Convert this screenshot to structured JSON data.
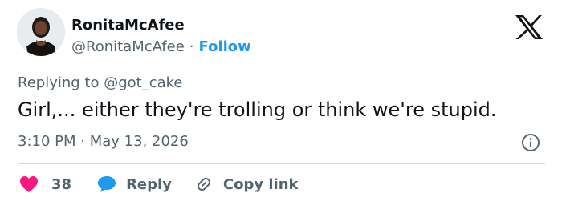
{
  "user": {
    "display_name": "RonitaMcAfee",
    "handle": "@RonitaMcAfee",
    "separator": "·",
    "follow_label": "Follow",
    "avatar": "profile-photo"
  },
  "brand": {
    "logo_icon": "x-logo-icon"
  },
  "reply_context": {
    "prefix": "Replying to",
    "to_handle": "@got_cake"
  },
  "tweet": {
    "text": "Girl,... either they're trolling or think we're stupid."
  },
  "meta": {
    "time": "3:10 PM",
    "separator": "·",
    "date": "May 13, 2026",
    "info_icon": "info-icon"
  },
  "actions": {
    "like_count": "38",
    "reply_label": "Reply",
    "copy_link_label": "Copy link"
  },
  "colors": {
    "text": "#0f1419",
    "secondary": "#536471",
    "accent": "#1d9bf0",
    "like": "#f91880",
    "divider": "#cfd9de"
  }
}
